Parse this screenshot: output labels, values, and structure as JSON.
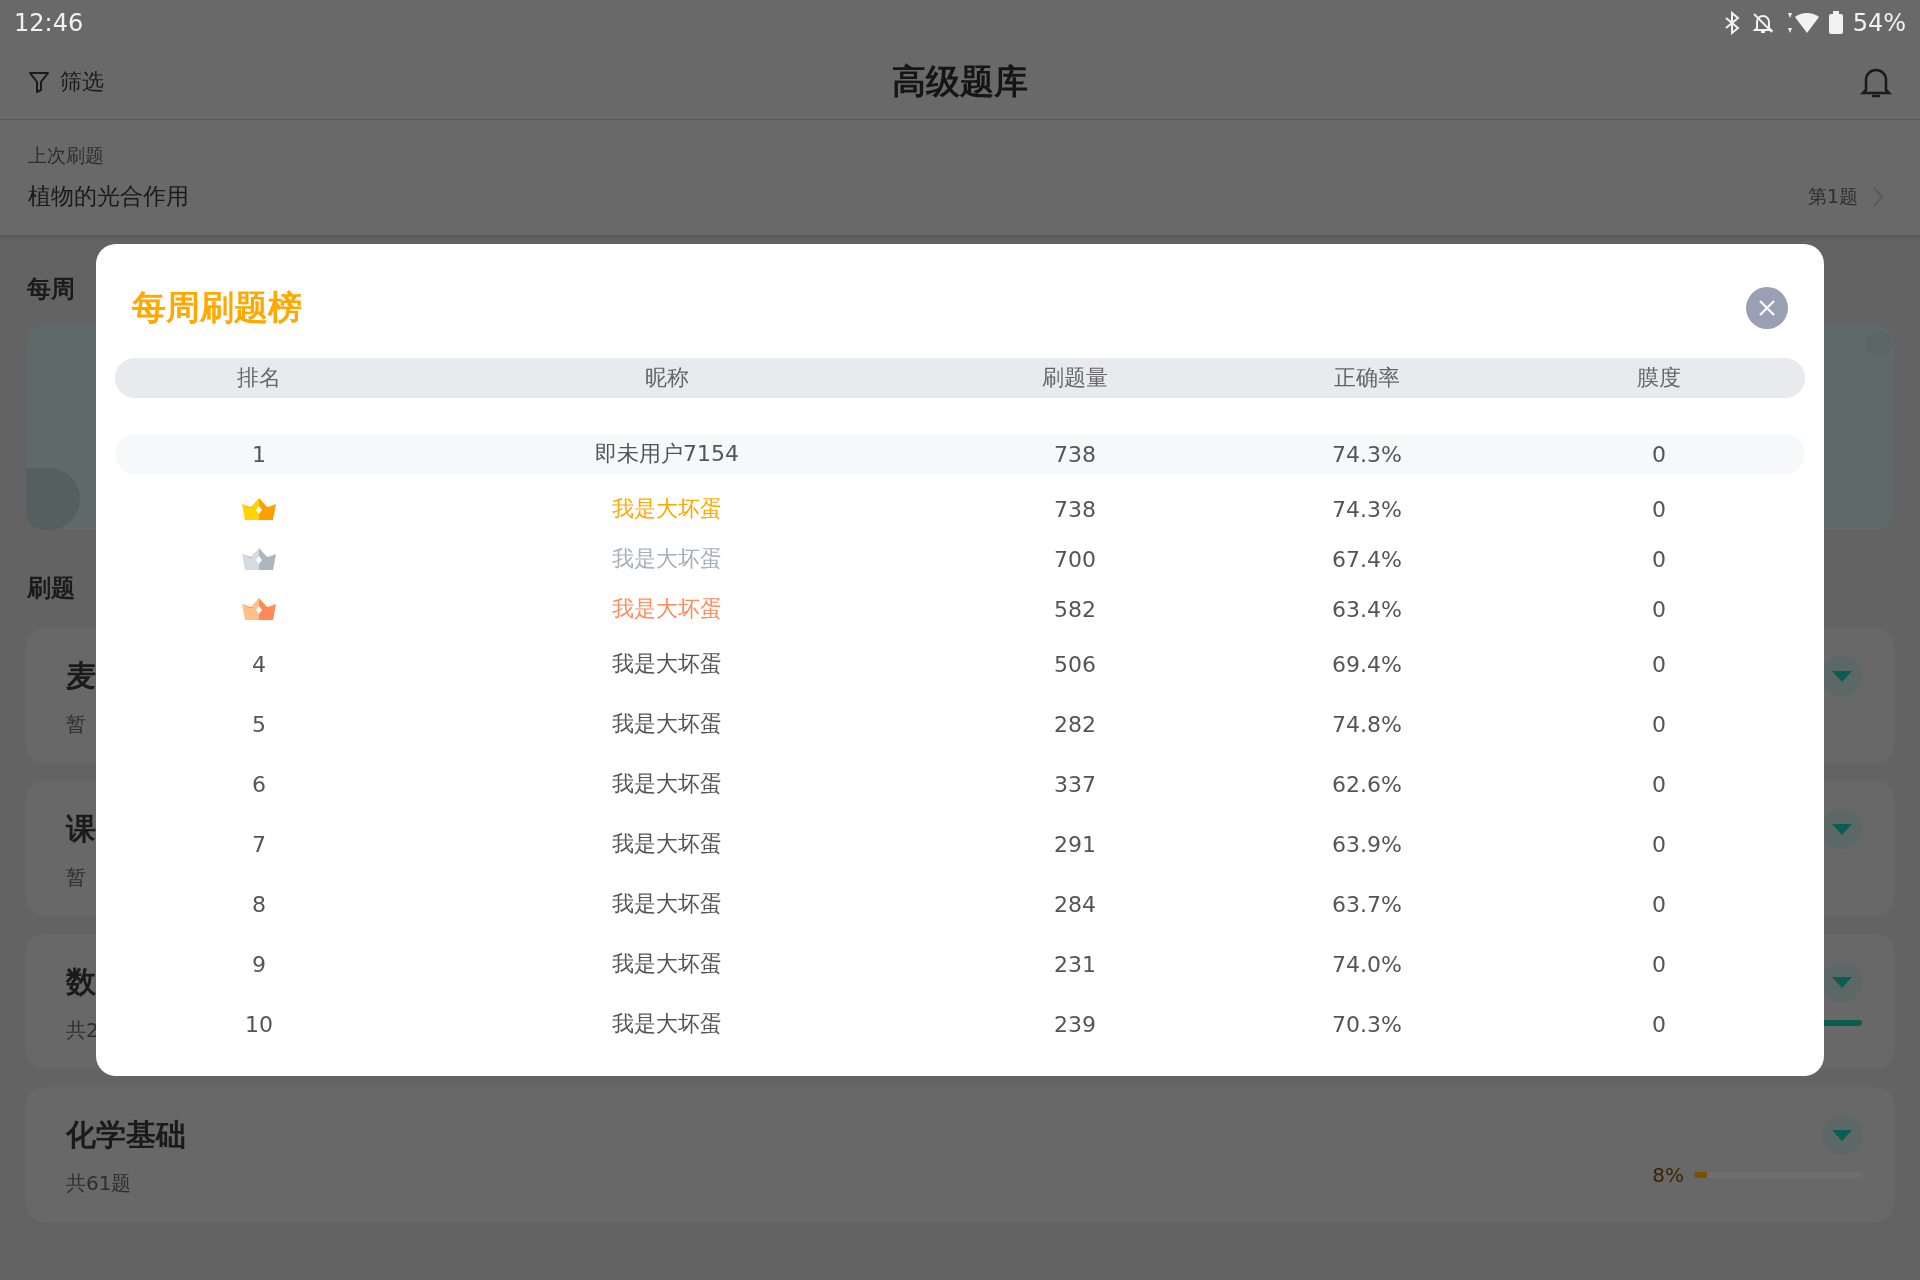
{
  "status_bar": {
    "time": "12:46",
    "battery": "54%"
  },
  "header": {
    "filter_label": "筛选",
    "title": "高级题库"
  },
  "last_practice": {
    "label": "上次刷题",
    "title": "植物的光合作用",
    "position": "第1题"
  },
  "weekly_section": {
    "title": "每周"
  },
  "list_section": {
    "title": "刷题",
    "items": [
      {
        "title": "麦",
        "subtitle": "暂",
        "progress_bar": false
      },
      {
        "title": "课",
        "subtitle": "暂",
        "progress_bar": false
      },
      {
        "title": "数",
        "subtitle": "共2",
        "progress_bar": true
      },
      {
        "title": "化学基础",
        "subtitle": "共61题",
        "progress_bar": false,
        "progress": {
          "label": "8%",
          "level": 0.08
        }
      }
    ]
  },
  "dialog": {
    "title": "每周刷题榜",
    "columns": [
      "排名",
      "昵称",
      "刷题量",
      "正确率",
      "膜度"
    ],
    "rows": [
      {
        "kind": "self",
        "rank": "1",
        "nickname": "即未用户7154",
        "count": "738",
        "accuracy": "74.3%",
        "likes": "0"
      },
      {
        "kind": "gold",
        "color": "#ffa800",
        "nickname": "我是大坏蛋",
        "count": "738",
        "accuracy": "74.3%",
        "likes": "0"
      },
      {
        "kind": "silver",
        "color": "#a4b0ba",
        "nickname": "我是大坏蛋",
        "count": "700",
        "accuracy": "67.4%",
        "likes": "0"
      },
      {
        "kind": "bronze",
        "color": "#ff8c5a",
        "nickname": "我是大坏蛋",
        "count": "582",
        "accuracy": "63.4%",
        "likes": "0"
      },
      {
        "kind": "plain",
        "rank": "4",
        "nickname": "我是大坏蛋",
        "count": "506",
        "accuracy": "69.4%",
        "likes": "0"
      },
      {
        "kind": "plain",
        "rank": "5",
        "nickname": "我是大坏蛋",
        "count": "282",
        "accuracy": "74.8%",
        "likes": "0"
      },
      {
        "kind": "plain",
        "rank": "6",
        "nickname": "我是大坏蛋",
        "count": "337",
        "accuracy": "62.6%",
        "likes": "0"
      },
      {
        "kind": "plain",
        "rank": "7",
        "nickname": "我是大坏蛋",
        "count": "291",
        "accuracy": "63.9%",
        "likes": "0"
      },
      {
        "kind": "plain",
        "rank": "8",
        "nickname": "我是大坏蛋",
        "count": "284",
        "accuracy": "63.7%",
        "likes": "0"
      },
      {
        "kind": "plain",
        "rank": "9",
        "nickname": "我是大坏蛋",
        "count": "231",
        "accuracy": "74.0%",
        "likes": "0"
      },
      {
        "kind": "plain",
        "rank": "10",
        "nickname": "我是大坏蛋",
        "count": "239",
        "accuracy": "70.3%",
        "likes": "0"
      }
    ]
  }
}
